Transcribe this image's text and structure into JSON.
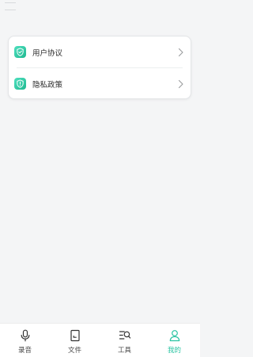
{
  "menu": {
    "items": [
      {
        "label": "用户协议",
        "icon": "shield-check-icon"
      },
      {
        "label": "隐私政策",
        "icon": "shield-exclamation-icon"
      }
    ]
  },
  "tabbar": {
    "items": [
      {
        "label": "录音",
        "icon": "microphone-icon",
        "active": false
      },
      {
        "label": "文件",
        "icon": "file-icon",
        "active": false
      },
      {
        "label": "工具",
        "icon": "tools-search-icon",
        "active": false
      },
      {
        "label": "我的",
        "icon": "person-icon",
        "active": true
      }
    ],
    "active_index": 3
  },
  "colors": {
    "accent": "#2bc4a2",
    "background": "#f4f5f6",
    "card": "#ffffff",
    "icon_gradient_start": "#4fe0bf",
    "icon_gradient_end": "#1fb890"
  }
}
